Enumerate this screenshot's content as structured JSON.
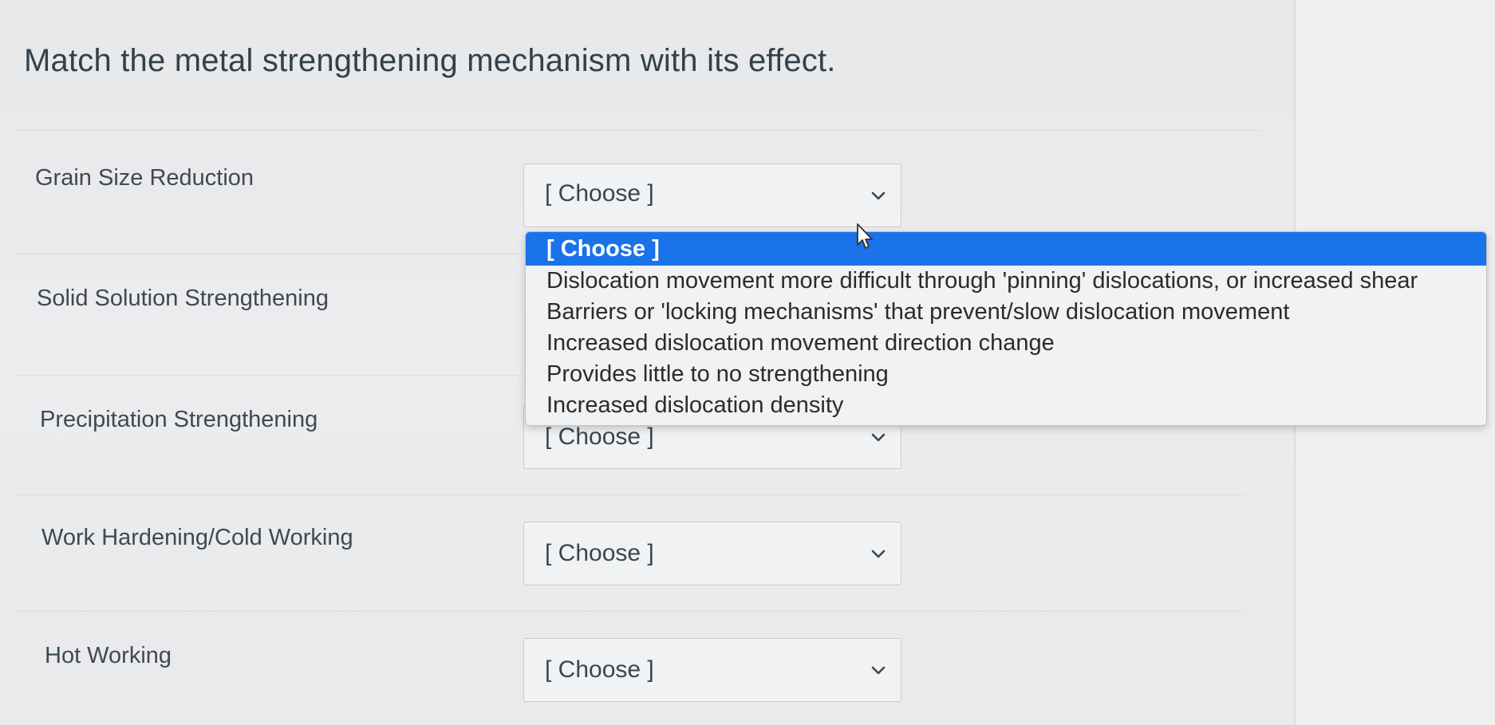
{
  "question": {
    "title": "Match the metal strengthening mechanism with its effect."
  },
  "rows": [
    {
      "label": "Grain Size Reduction",
      "selected": "[ Choose ]"
    },
    {
      "label": "Solid Solution Strengthening",
      "selected": "[ Choose ]"
    },
    {
      "label": "Precipitation Strengthening",
      "selected": "[ Choose ]"
    },
    {
      "label": "Work Hardening/Cold Working",
      "selected": "[ Choose ]"
    },
    {
      "label": "Hot Working",
      "selected": "[ Choose ]"
    }
  ],
  "dropdown": {
    "options": [
      "[ Choose ]",
      "Dislocation movement more difficult through 'pinning' dislocations, or increased shear",
      "Barriers or 'locking mechanisms' that prevent/slow dislocation movement",
      "Increased dislocation movement direction change",
      "Provides little to no strengthening",
      "Increased dislocation density"
    ],
    "highlight_color": "#1a73e8"
  },
  "icons": {
    "select_arrow": "chevron-down-icon",
    "pointer": "mouse-cursor-icon"
  }
}
